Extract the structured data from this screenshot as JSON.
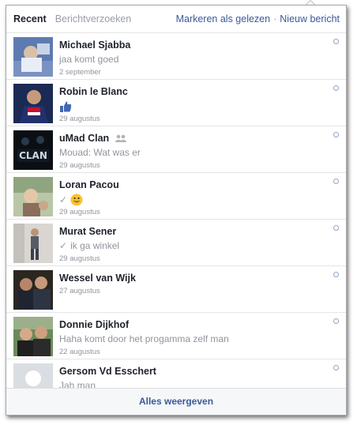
{
  "header": {
    "tab_recent": "Recent",
    "tab_requests": "Berichtverzoeken",
    "mark_read": "Markeren als gelezen",
    "separator": "·",
    "new_message": "Nieuw bericht"
  },
  "conversations": [
    {
      "name": "Michael Sjabba",
      "snippet": "jaa komt goed",
      "date": "2 september"
    },
    {
      "name": "Robin le Blanc",
      "snippet": "",
      "date": "29 augustus"
    },
    {
      "name": "uMad Clan",
      "snippet": "Mouad: Wat was er",
      "date": "29 augustus"
    },
    {
      "name": "Loran Pacou",
      "snippet": "",
      "date": "29 augustus"
    },
    {
      "name": "Murat Sener",
      "snippet": "ik ga winkel",
      "date": "29 augustus"
    },
    {
      "name": "Wessel van Wijk",
      "snippet": "",
      "date": "27 augustus"
    },
    {
      "name": "Donnie Dijkhof",
      "snippet": "Haha komt door het progamma zelf man",
      "date": "22 augustus"
    },
    {
      "name": "Gersom Vd Esschert",
      "snippet": "Jah man",
      "date": ""
    }
  ],
  "footer": {
    "see_all": "Alles weergeven"
  },
  "avatar_3_text": "CLAN",
  "colors": {
    "link": "#3b5998",
    "muted": "#90949c",
    "text": "#1d2129"
  }
}
